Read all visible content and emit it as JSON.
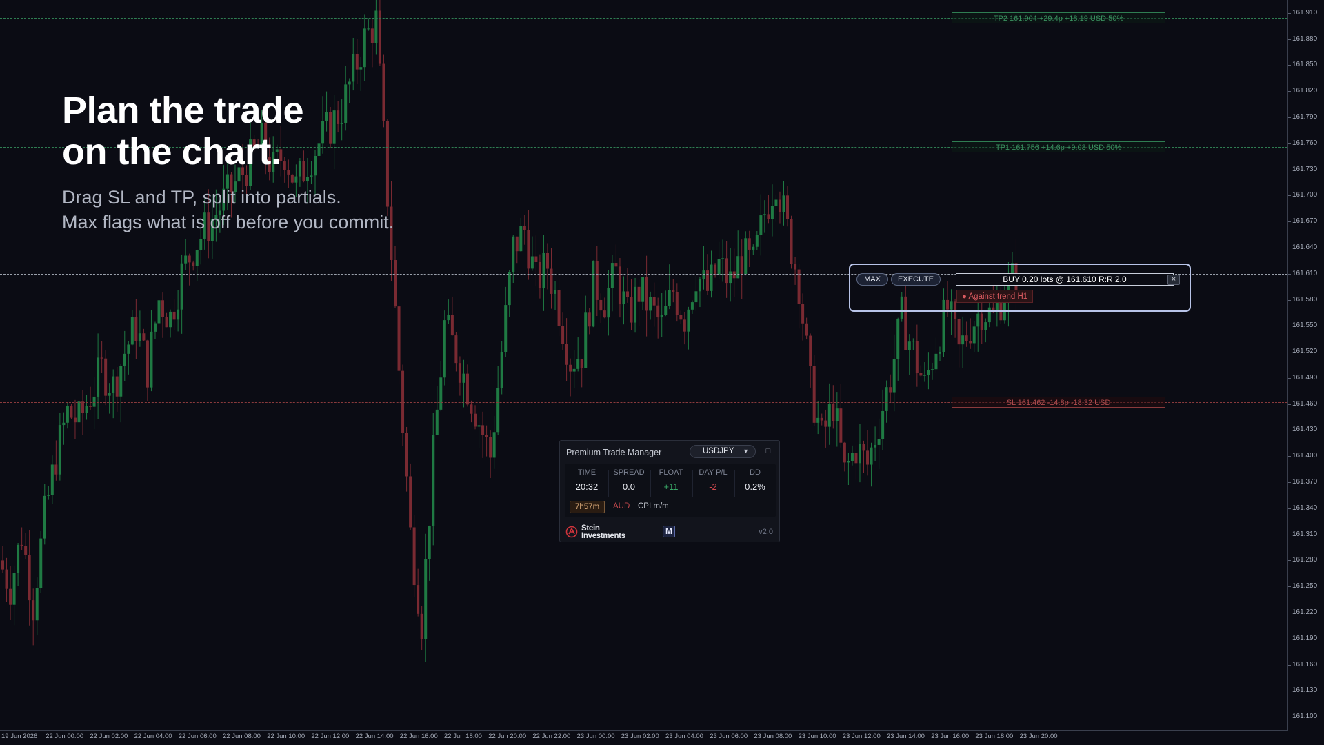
{
  "headline": {
    "line1": "Plan the trade",
    "line2": "on the chart."
  },
  "subline": {
    "line1": "Drag SL and TP, split into partials.",
    "line2": "Max flags what is off before you commit."
  },
  "levels": {
    "tp2": {
      "price": 161.904,
      "label": "TP2  161.904  +29.4p  +18.19 USD  50%"
    },
    "tp1": {
      "price": 161.756,
      "label": "TP1  161.756  +14.6p  +9.03 USD  50%"
    },
    "entry": {
      "price": 161.61
    },
    "sl": {
      "price": 161.462,
      "label": "SL  161.462  -14.8p  -18.32 USD"
    }
  },
  "trade_box": {
    "max_label": "MAX",
    "execute_label": "EXECUTE",
    "order_text": "BUY  0.20 lots  @ 161.610   R:R 2.0",
    "close_label": "×",
    "warning": "● Against trend H1"
  },
  "panel": {
    "title": "Premium Trade Manager",
    "symbol": "USDJPY",
    "symbol_caret": "▼",
    "minimize_label": "□",
    "stats": [
      {
        "head": "TIME",
        "value": "20:32",
        "color": "#e6e8ee"
      },
      {
        "head": "SPREAD",
        "value": "0.0",
        "color": "#e6e8ee"
      },
      {
        "head": "FLOAT",
        "value": "+11",
        "color": "#3aa868"
      },
      {
        "head": "DAY P/L",
        "value": "-2",
        "color": "#d0484d"
      },
      {
        "head": "DD",
        "value": "0.2%",
        "color": "#e6e8ee"
      }
    ],
    "session_chip": "7h57m",
    "currency": "AUD",
    "event": "CPI m/m",
    "brand_line1": "Stein",
    "brand_line2": "Investments",
    "m_badge": "M",
    "version": "v2.0"
  },
  "axis": {
    "price_ticks": [
      "161.910",
      "161.880",
      "161.850",
      "161.820",
      "161.790",
      "161.760",
      "161.730",
      "161.700",
      "161.670",
      "161.640",
      "161.610",
      "161.580",
      "161.550",
      "161.520",
      "161.490",
      "161.460",
      "161.430",
      "161.400",
      "161.370",
      "161.340",
      "161.310",
      "161.280",
      "161.250",
      "161.220",
      "161.190",
      "161.160",
      "161.130",
      "161.100"
    ],
    "time_ticks": [
      "19 Jun 2026",
      "22 Jun 00:00",
      "22 Jun 02:00",
      "22 Jun 04:00",
      "22 Jun 06:00",
      "22 Jun 08:00",
      "22 Jun 10:00",
      "22 Jun 12:00",
      "22 Jun 14:00",
      "22 Jun 16:00",
      "22 Jun 18:00",
      "22 Jun 20:00",
      "22 Jun 22:00",
      "23 Jun 00:00",
      "23 Jun 02:00",
      "23 Jun 04:00",
      "23 Jun 06:00",
      "23 Jun 08:00",
      "23 Jun 10:00",
      "23 Jun 12:00",
      "23 Jun 14:00",
      "23 Jun 16:00",
      "23 Jun 18:00",
      "23 Jun 20:00"
    ]
  },
  "colors": {
    "bull": "#1f7a43",
    "bear": "#7a2a32",
    "wick": "#3b5a4a"
  },
  "chart_data": {
    "type": "candlestick",
    "symbol": "USDJPY",
    "ylim": [
      161.085,
      161.925
    ],
    "close_path": [
      161.28,
      161.25,
      161.31,
      161.23,
      161.33,
      161.4,
      161.45,
      161.44,
      161.47,
      161.5,
      161.48,
      161.52,
      161.55,
      161.5,
      161.58,
      161.56,
      161.61,
      161.64,
      161.66,
      161.68,
      161.7,
      161.72,
      161.74,
      161.76,
      161.73,
      161.75,
      161.71,
      161.74,
      161.76,
      161.78,
      161.8,
      161.84,
      161.88,
      161.9,
      161.7,
      161.5,
      161.31,
      161.21,
      161.4,
      161.55,
      161.52,
      161.48,
      161.44,
      161.4,
      161.52,
      161.64,
      161.66,
      161.6,
      161.62,
      161.57,
      161.51,
      161.52,
      161.6,
      161.58,
      161.61,
      161.56,
      161.59,
      161.57,
      161.55,
      161.59,
      161.56,
      161.61,
      161.59,
      161.62,
      161.6,
      161.63,
      161.62,
      161.68,
      161.72,
      161.66,
      161.6,
      161.48,
      161.42,
      161.46,
      161.38,
      161.41,
      161.39,
      161.44,
      161.49,
      161.56,
      161.52,
      161.48,
      161.53,
      161.57,
      161.52,
      161.55,
      161.57,
      161.56,
      161.59,
      161.61
    ]
  }
}
